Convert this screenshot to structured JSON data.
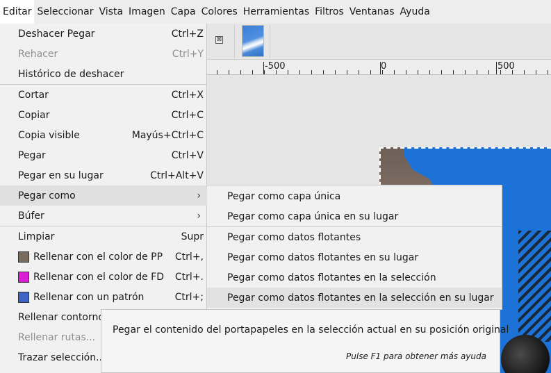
{
  "menubar": [
    "Editar",
    "Seleccionar",
    "Vista",
    "Imagen",
    "Capa",
    "Colores",
    "Herramientas",
    "Filtros",
    "Ventanas",
    "Ayuda"
  ],
  "tab_close_glyph": "⊠",
  "ruler": {
    "labels": [
      "-500",
      "0",
      "500"
    ]
  },
  "edit_menu": {
    "items": [
      {
        "label": "Deshacer Pegar",
        "shortcut": "Ctrl+Z"
      },
      {
        "label": "Rehacer",
        "shortcut": "Ctrl+Y",
        "disabled": true
      },
      {
        "label": "Histórico de deshacer",
        "shortcut": ""
      },
      {
        "label": "Cortar",
        "shortcut": "Ctrl+X"
      },
      {
        "label": "Copiar",
        "shortcut": "Ctrl+C"
      },
      {
        "label": "Copia visible",
        "shortcut": "Mayús+Ctrl+C"
      },
      {
        "label": "Pegar",
        "shortcut": "Ctrl+V"
      },
      {
        "label": "Pegar en su lugar",
        "shortcut": "Ctrl+Alt+V"
      },
      {
        "label": "Pegar como",
        "shortcut": "",
        "submenu": true,
        "highlight": true
      },
      {
        "label": "Búfer",
        "shortcut": "",
        "submenu": true
      },
      {
        "label": "Limpiar",
        "shortcut": "Supr"
      },
      {
        "label": "Rellenar con el color de PP",
        "shortcut": "Ctrl+,",
        "swatch": "#7a6c5d"
      },
      {
        "label": "Rellenar con el color de FD",
        "shortcut": "Ctrl+.",
        "swatch": "#d91fd6"
      },
      {
        "label": "Rellenar con un patrón",
        "shortcut": "Ctrl+;",
        "swatch": "#3f63c4"
      },
      {
        "label": "Rellenar contorno",
        "shortcut": ""
      },
      {
        "label": "Rellenar rutas...",
        "shortcut": "",
        "disabled": true
      },
      {
        "label": "Trazar selección...",
        "shortcut": ""
      }
    ],
    "submenu_arrow": "›"
  },
  "paste_as_submenu": {
    "items": [
      {
        "label": "Pegar como capa única"
      },
      {
        "label": "Pegar como capa única en su lugar"
      },
      {
        "label": "Pegar como datos flotantes"
      },
      {
        "label": "Pegar como datos flotantes en su lugar"
      },
      {
        "label": "Pegar como datos flotantes en la selección"
      },
      {
        "label": "Pegar como datos flotantes en la selección en su lugar",
        "highlight": true
      }
    ]
  },
  "tooltip": {
    "text": "Pegar el contenido del portapapeles en la selección actual en su posición original",
    "hint": "Pulse F1 para obtener más ayuda"
  }
}
